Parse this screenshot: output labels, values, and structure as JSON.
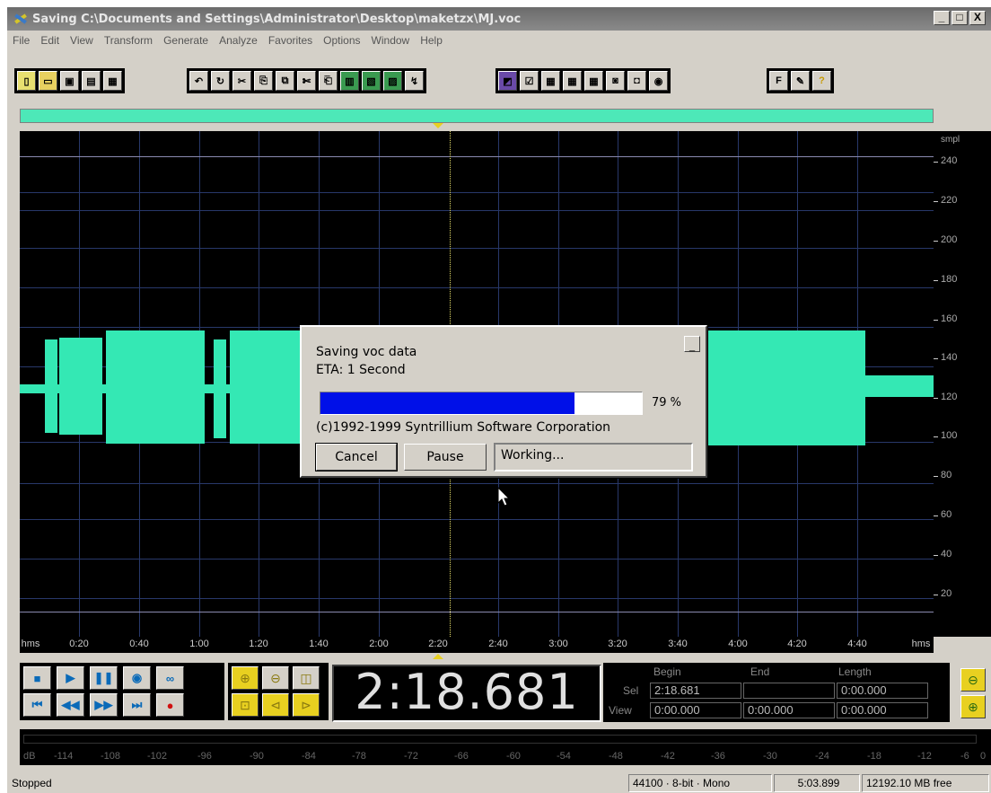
{
  "window": {
    "title": "Saving C:\\Documents and Settings\\Administrator\\Desktop\\maketzx\\MJ.voc",
    "minimize": "_",
    "maximize": "□",
    "close": "X"
  },
  "menu": [
    "File",
    "Edit",
    "View",
    "Transform",
    "Generate",
    "Analyze",
    "Favorites",
    "Options",
    "Window",
    "Help"
  ],
  "dialog": {
    "line1": "Saving voc data",
    "line2": "ETA: 1 Second",
    "progress_percent": 79,
    "percent_label": "79 %",
    "copyright": "(c)1992-1999 Syntrillium Software Corporation",
    "cancel_label": "Cancel",
    "pause_label": "Pause",
    "status_text": "Working..."
  },
  "waveform_axis": {
    "unit": "smpl",
    "labels": [
      "240",
      "220",
      "200",
      "180",
      "160",
      "140",
      "120",
      "100",
      "80",
      "60",
      "40",
      "20"
    ]
  },
  "time_ruler": {
    "start_label": "hms",
    "end_label": "hms",
    "labels": [
      "0:20",
      "0:40",
      "1:00",
      "1:20",
      "1:40",
      "2:00",
      "2:20",
      "2:40",
      "3:00",
      "3:20",
      "3:40",
      "4:00",
      "4:20",
      "4:40"
    ]
  },
  "time_display": "2:18.681",
  "selection": {
    "begin_header": "Begin",
    "end_header": "End",
    "length_header": "Length",
    "sel_label": "Sel",
    "view_label": "View",
    "sel_begin": "2:18.681",
    "sel_end": "",
    "sel_length": "0:00.000",
    "view_begin": "0:00.000",
    "view_end": "0:00.000",
    "view_length": "0:00.000"
  },
  "level_meter": {
    "labels": [
      "dB",
      "-114",
      "-108",
      "-102",
      "-96",
      "-90",
      "-84",
      "-78",
      "-72",
      "-66",
      "-60",
      "-54",
      "-48",
      "-42",
      "-36",
      "-30",
      "-24",
      "-18",
      "-12",
      "-6",
      "0"
    ]
  },
  "status": {
    "state": "Stopped",
    "format": "44100 · 8-bit · Mono",
    "duration": "5:03.899",
    "free_space": "12192.10 MB free"
  },
  "colors": {
    "waveform": "#34e8b4",
    "progress": "#0010e8",
    "background": "#000000"
  }
}
